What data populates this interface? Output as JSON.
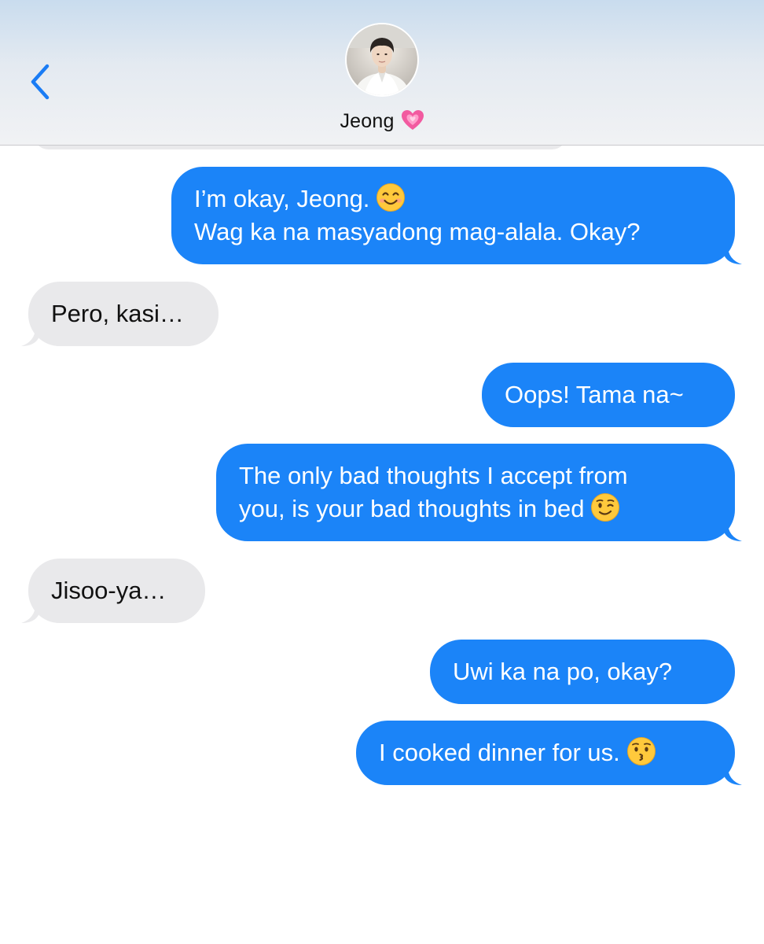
{
  "header": {
    "contact_name": "Jeong",
    "name_emoji": "growing-heart-icon"
  },
  "messages": [
    {
      "sender": "me",
      "lines": [
        "I’m okay, Jeong.",
        "Wag ka na masyadong mag-alala. Okay?"
      ],
      "emoji": "smiling-face-icon"
    },
    {
      "sender": "them",
      "lines": [
        "Pero, kasi…"
      ]
    },
    {
      "sender": "me",
      "lines": [
        "Oops! Tama na~"
      ]
    },
    {
      "sender": "me",
      "lines": [
        "The only bad thoughts I accept from",
        "you, is your bad thoughts in bed"
      ],
      "emoji": "winking-face-icon"
    },
    {
      "sender": "them",
      "lines": [
        "Jisoo-ya…"
      ]
    },
    {
      "sender": "me",
      "lines": [
        "Uwi ka na po, okay?"
      ]
    },
    {
      "sender": "me",
      "lines": [
        "I cooked dinner for us."
      ],
      "emoji": "kissing-face-icon"
    }
  ],
  "colors": {
    "sent_bubble": "#1b84f8",
    "received_bubble": "#e9e9eb",
    "accent": "#1a7cf5"
  }
}
